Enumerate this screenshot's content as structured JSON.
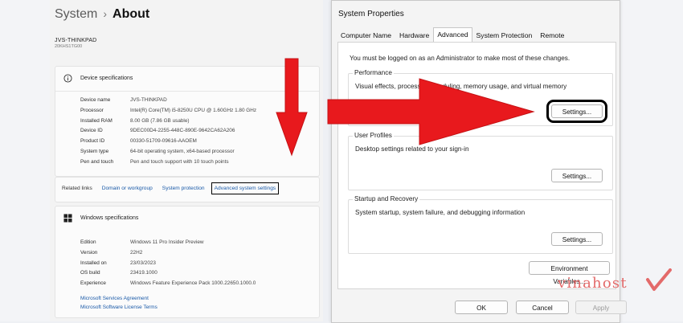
{
  "settings": {
    "breadcrumb_parent": "System",
    "breadcrumb_separator": "›",
    "breadcrumb_current": "About",
    "device_name": "JVS-THINKPAD",
    "device_model": "20KHS1TG00",
    "device_specs": {
      "title": "Device specifications",
      "rows": [
        {
          "label": "Device name",
          "value": "JVS-THINKPAD"
        },
        {
          "label": "Processor",
          "value": "Intel(R) Core(TM) i5-8250U CPU @ 1.60GHz   1.80 GHz"
        },
        {
          "label": "Installed RAM",
          "value": "8.00 GB (7.86 GB usable)"
        },
        {
          "label": "Device ID",
          "value": "9DEC00D4-2255-448C-890E-9642CA62A206"
        },
        {
          "label": "Product ID",
          "value": "00330-51709-09616-AAOEM"
        },
        {
          "label": "System type",
          "value": "64-bit operating system, x64-based processor"
        },
        {
          "label": "Pen and touch",
          "value": "Pen and touch support with 10 touch points"
        }
      ]
    },
    "related_links": {
      "label": "Related links",
      "links": [
        "Domain or workgroup",
        "System protection",
        "Advanced system settings"
      ]
    },
    "windows_specs": {
      "title": "Windows specifications",
      "rows": [
        {
          "label": "Edition",
          "value": "Windows 11 Pro Insider Preview"
        },
        {
          "label": "Version",
          "value": "22H2"
        },
        {
          "label": "Installed on",
          "value": "23/03/2023"
        },
        {
          "label": "OS build",
          "value": "23419.1000"
        },
        {
          "label": "Experience",
          "value": "Windows Feature Experience Pack 1000.22650.1000.0"
        }
      ],
      "links": [
        "Microsoft Services Agreement",
        "Microsoft Software License Terms"
      ]
    }
  },
  "dialog": {
    "title": "System Properties",
    "tabs": [
      "Computer Name",
      "Hardware",
      "Advanced",
      "System Protection",
      "Remote"
    ],
    "active_tab": "Advanced",
    "admin_note": "You must be logged on as an Administrator to make most of these changes.",
    "performance": {
      "label": "Performance",
      "description": "Visual effects, processor scheduling, memory usage, and virtual memory",
      "button": "Settings..."
    },
    "user_profiles": {
      "label": "User Profiles",
      "description": "Desktop settings related to your sign-in",
      "button": "Settings..."
    },
    "startup_recovery": {
      "label": "Startup and Recovery",
      "description": "System startup, system failure, and debugging information",
      "button": "Settings..."
    },
    "env_button": "Environment Variables...",
    "ok": "OK",
    "cancel": "Cancel",
    "apply": "Apply"
  },
  "watermark": "vinahost",
  "colors": {
    "arrow": "#e8191d",
    "link": "#1a5aa8",
    "highlight_box": "#000000",
    "watermark": "#e36a6a"
  },
  "icons": {
    "device_specs": "info-icon",
    "windows_specs": "windows-logo-icon"
  }
}
